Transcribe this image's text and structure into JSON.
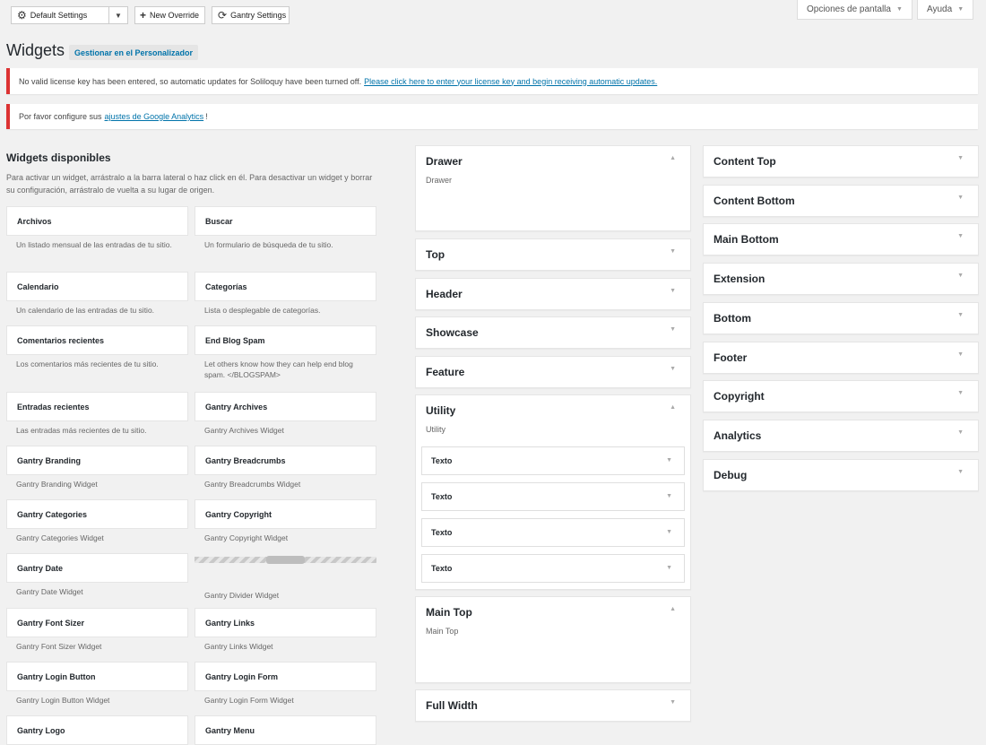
{
  "toolbar": {
    "default_settings": "Default Settings",
    "new_override": "New Override",
    "gantry_settings": "Gantry Settings",
    "screen_options": "Opciones de pantalla",
    "help": "Ayuda"
  },
  "header": {
    "title": "Widgets",
    "customizer": "Gestionar en el Personalizador"
  },
  "notices": {
    "license_text": "No valid license key has been entered, so automatic updates for Soliloquy have been turned off.",
    "license_link": "Please click here to enter your license key and begin receiving automatic updates.",
    "analytics_prefix": "Por favor configure sus",
    "analytics_link": "ajustes de Google Analytics",
    "analytics_suffix": "!"
  },
  "available": {
    "title": "Widgets disponibles",
    "description": "Para activar un widget, arrástralo a la barra lateral o haz click en él. Para desactivar un widget y borrar su configuración, arrástralo de vuelta a su lugar de origen.",
    "widgets": [
      {
        "name": "Archivos",
        "desc": "Un listado mensual de las entradas de tu sitio."
      },
      {
        "name": "Buscar",
        "desc": "Un formulario de búsqueda de tu sitio."
      },
      {
        "name": "Calendario",
        "desc": "Un calendario de las entradas de tu sitio."
      },
      {
        "name": "Categorías",
        "desc": "Lista o desplegable de categorías."
      },
      {
        "name": "Comentarios recientes",
        "desc": "Los comentarios más recientes de tu sitio."
      },
      {
        "name": "End Blog Spam",
        "desc": "Let others know how they can help end blog spam. </BLOGSPAM>"
      },
      {
        "name": "Entradas recientes",
        "desc": "Las entradas más recientes de tu sitio."
      },
      {
        "name": "Gantry Archives",
        "desc": "Gantry Archives Widget"
      },
      {
        "name": "Gantry Branding",
        "desc": "Gantry Branding Widget"
      },
      {
        "name": "Gantry Breadcrumbs",
        "desc": "Gantry Breadcrumbs Widget"
      },
      {
        "name": "Gantry Categories",
        "desc": "Gantry Categories Widget"
      },
      {
        "name": "Gantry Copyright",
        "desc": "Gantry Copyright Widget"
      },
      {
        "name": "Gantry Date",
        "desc": "Gantry Date Widget"
      },
      {
        "name": "",
        "desc": "Gantry Divider Widget"
      },
      {
        "name": "Gantry Font Sizer",
        "desc": "Gantry Font Sizer Widget"
      },
      {
        "name": "Gantry Links",
        "desc": "Gantry Links Widget"
      },
      {
        "name": "Gantry Login Button",
        "desc": "Gantry Login Button Widget"
      },
      {
        "name": "Gantry Login Form",
        "desc": "Gantry Login Form Widget"
      },
      {
        "name": "Gantry Logo",
        "desc": ""
      },
      {
        "name": "Gantry Menu",
        "desc": ""
      }
    ]
  },
  "sidebars_middle": [
    {
      "title": "Drawer",
      "sub": "Drawer"
    },
    {
      "title": "Top"
    },
    {
      "title": "Header"
    },
    {
      "title": "Showcase"
    },
    {
      "title": "Feature"
    },
    {
      "title": "Utility",
      "sub": "Utility",
      "widgets": [
        "Texto",
        "Texto",
        "Texto",
        "Texto"
      ]
    },
    {
      "title": "Main Top",
      "sub": "Main Top"
    },
    {
      "title": "Full Width"
    }
  ],
  "sidebars_right": [
    {
      "title": "Content Top"
    },
    {
      "title": "Content Bottom"
    },
    {
      "title": "Main Bottom"
    },
    {
      "title": "Extension"
    },
    {
      "title": "Bottom"
    },
    {
      "title": "Footer"
    },
    {
      "title": "Copyright"
    },
    {
      "title": "Analytics"
    },
    {
      "title": "Debug"
    }
  ]
}
